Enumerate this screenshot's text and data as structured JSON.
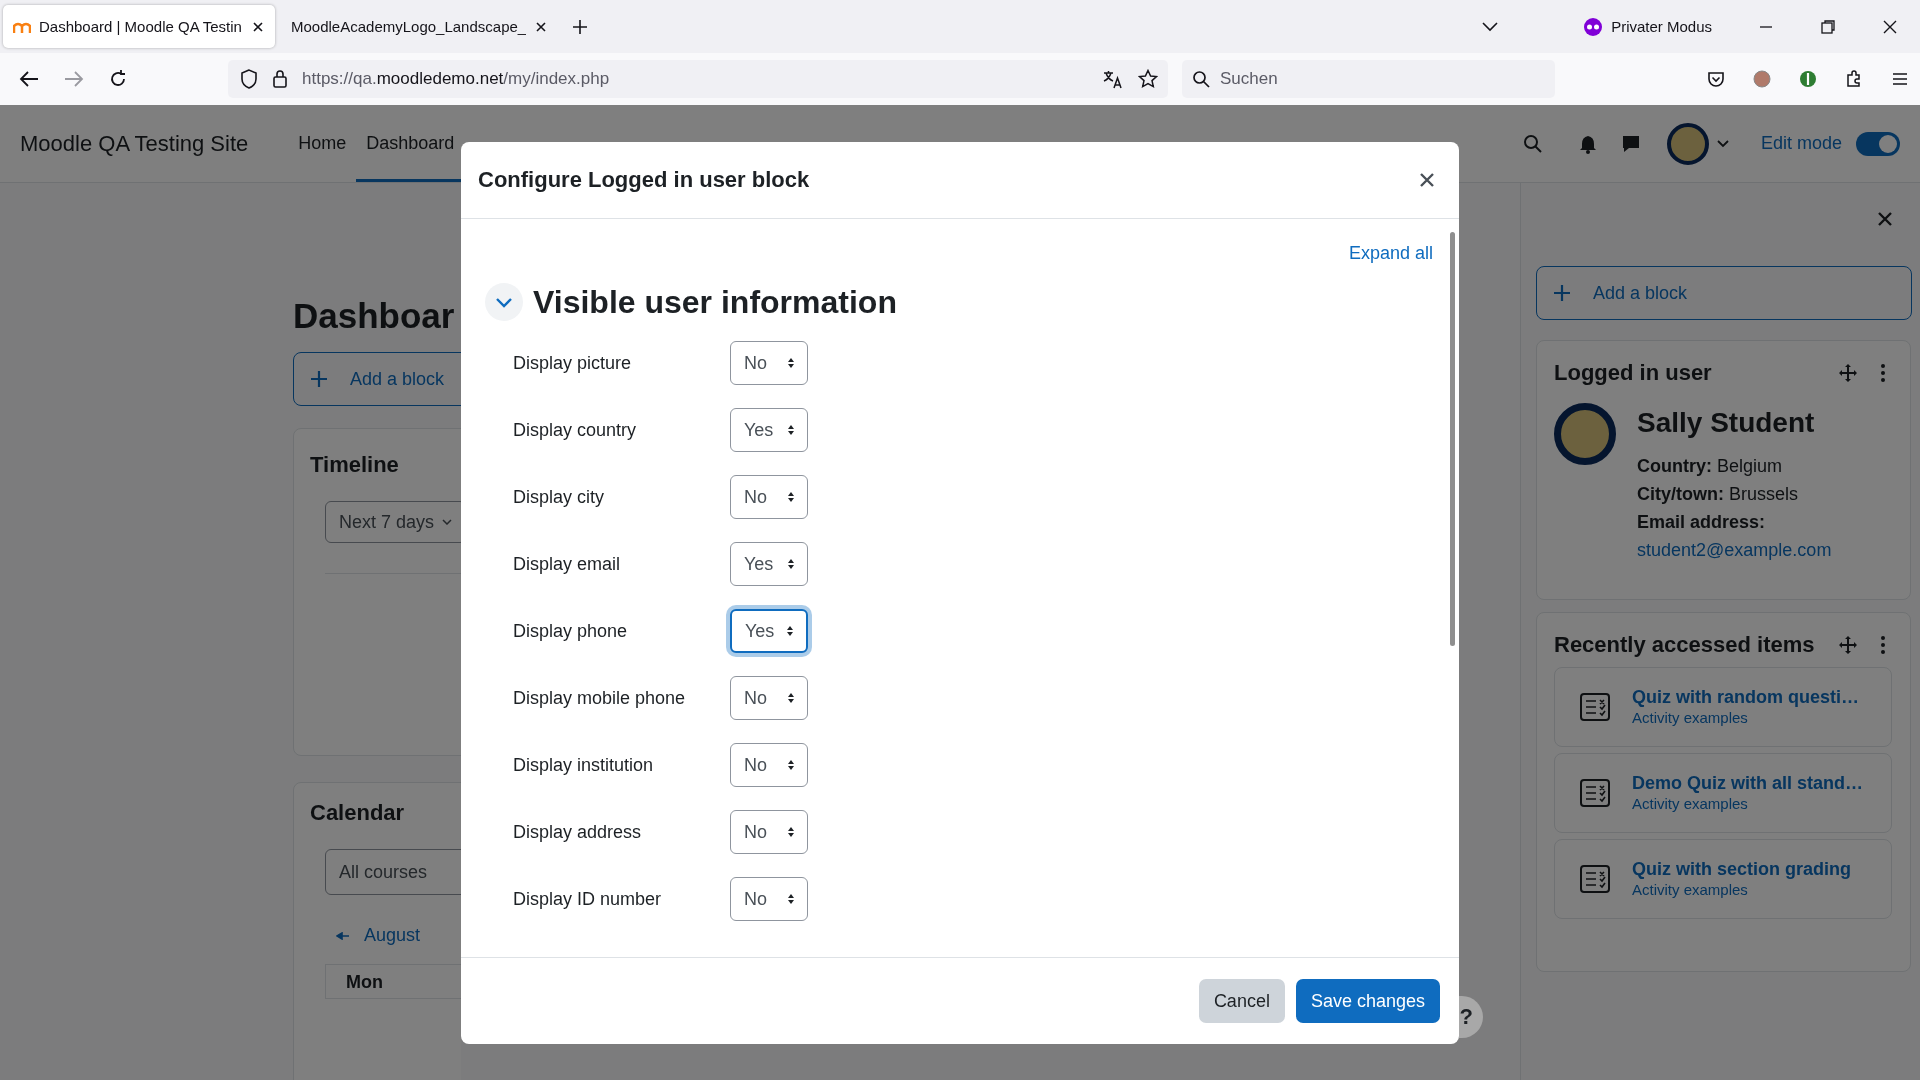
{
  "browser": {
    "tabs": [
      {
        "title": "Dashboard | Moodle QA Testin",
        "selected": true
      },
      {
        "title": "MoodleAcademyLogo_Landscape_",
        "selected": false
      }
    ],
    "private_mode": "Privater Modus",
    "url": {
      "prefix": "https://qa.",
      "domain": "moodledemo.net",
      "path": "/my/index.php"
    },
    "search": {
      "placeholder": "Suchen"
    }
  },
  "site": {
    "title": "Moodle QA Testing Site",
    "nav": [
      {
        "label": "Home",
        "selected": false
      },
      {
        "label": "Dashboard",
        "selected": true
      }
    ],
    "edit_mode": {
      "label": "Edit mode",
      "on": true
    }
  },
  "dashboard": {
    "title": "Dashboar",
    "add_block": "Add a block",
    "timeline": {
      "title": "Timeline",
      "filter": "Next 7 days"
    },
    "calendar": {
      "title": "Calendar",
      "course_filter": "All courses",
      "month": "August",
      "day": "Mon"
    }
  },
  "drawer": {
    "add_block": "Add a block",
    "logged_in": {
      "title": "Logged in user",
      "name": "Sally Student",
      "fields": [
        {
          "label": "Country:",
          "value": "Belgium"
        },
        {
          "label": "City/town:",
          "value": "Brussels"
        }
      ],
      "email_label": "Email address:",
      "email": "student2@example.com"
    },
    "recent": {
      "title": "Recently accessed items",
      "items": [
        {
          "name": "Quiz with random questi…",
          "course": "Activity examples"
        },
        {
          "name": "Demo Quiz with all stand…",
          "course": "Activity examples"
        },
        {
          "name": "Quiz with section grading",
          "course": "Activity examples"
        }
      ]
    }
  },
  "modal": {
    "title": "Configure Logged in user block",
    "expand_all": "Expand all",
    "section": {
      "title": "Visible user information",
      "expanded": true
    },
    "settings": [
      {
        "label": "Display picture",
        "value": "No",
        "focused": false
      },
      {
        "label": "Display country",
        "value": "Yes",
        "focused": false
      },
      {
        "label": "Display city",
        "value": "No",
        "focused": false
      },
      {
        "label": "Display email",
        "value": "Yes",
        "focused": false
      },
      {
        "label": "Display phone",
        "value": "Yes",
        "focused": true
      },
      {
        "label": "Display mobile phone",
        "value": "No",
        "focused": false
      },
      {
        "label": "Display institution",
        "value": "No",
        "focused": false
      },
      {
        "label": "Display address",
        "value": "No",
        "focused": false
      },
      {
        "label": "Display ID number",
        "value": "No",
        "focused": false
      }
    ],
    "buttons": [
      {
        "label": "Cancel",
        "kind": "secondary"
      },
      {
        "label": "Save changes",
        "kind": "primary"
      }
    ]
  },
  "help": {
    "label": "?"
  }
}
